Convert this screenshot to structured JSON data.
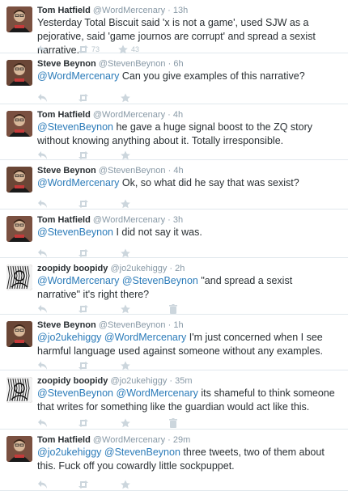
{
  "tweets": [
    {
      "name": "Tom Hatfield",
      "handle": "@WordMercenary",
      "time": "13h",
      "segments": [
        {
          "t": "Yesterday Total Biscuit said 'x is not a game', used SJW as a pejorative, said 'game journos are corrupt' and spread a sexist narrative.",
          "m": false
        }
      ],
      "retweets": "73",
      "favorites": "43",
      "has_delete": false,
      "avatar": "tom"
    },
    {
      "name": "Steve Beynon",
      "handle": "@StevenBeynon",
      "time": "6h",
      "segments": [
        {
          "t": "@WordMercenary",
          "m": true
        },
        {
          "t": " Can you give examples of this narrative?",
          "m": false
        }
      ],
      "retweets": "",
      "favorites": "",
      "has_delete": false,
      "avatar": "steve"
    },
    {
      "name": "Tom Hatfield",
      "handle": "@WordMercenary",
      "time": "4h",
      "segments": [
        {
          "t": "@StevenBeynon",
          "m": true
        },
        {
          "t": " he gave a huge signal boost to the ZQ story without knowing anything about it. Totally irresponsible.",
          "m": false
        }
      ],
      "retweets": "",
      "favorites": "",
      "has_delete": false,
      "avatar": "tom"
    },
    {
      "name": "Steve Beynon",
      "handle": "@StevenBeynon",
      "time": "4h",
      "segments": [
        {
          "t": "@WordMercenary",
          "m": true
        },
        {
          "t": " Ok, so what did he say that was sexist?",
          "m": false
        }
      ],
      "retweets": "",
      "favorites": "",
      "has_delete": false,
      "avatar": "steve"
    },
    {
      "name": "Tom Hatfield",
      "handle": "@WordMercenary",
      "time": "3h",
      "segments": [
        {
          "t": "@StevenBeynon",
          "m": true
        },
        {
          "t": " I did not say it was.",
          "m": false
        }
      ],
      "retweets": "",
      "favorites": "",
      "has_delete": false,
      "avatar": "tom"
    },
    {
      "name": "zoopidy boopidy",
      "handle": "@jo2ukehiggy",
      "time": "2h",
      "segments": [
        {
          "t": "@WordMercenary",
          "m": true
        },
        {
          "t": " ",
          "m": false
        },
        {
          "t": "@StevenBeynon",
          "m": true
        },
        {
          "t": " \"and spread a sexist narrative\" it's right there?",
          "m": false
        }
      ],
      "retweets": "",
      "favorites": "",
      "has_delete": true,
      "avatar": "zoop"
    },
    {
      "name": "Steve Beynon",
      "handle": "@StevenBeynon",
      "time": "1h",
      "segments": [
        {
          "t": "@jo2ukehiggy",
          "m": true
        },
        {
          "t": " ",
          "m": false
        },
        {
          "t": "@WordMercenary",
          "m": true
        },
        {
          "t": " I'm just concerned when I see harmful language used against someone without any examples.",
          "m": false
        }
      ],
      "retweets": "",
      "favorites": "",
      "has_delete": false,
      "avatar": "steve"
    },
    {
      "name": "zoopidy boopidy",
      "handle": "@jo2ukehiggy",
      "time": "35m",
      "segments": [
        {
          "t": "@StevenBeynon",
          "m": true
        },
        {
          "t": " ",
          "m": false
        },
        {
          "t": "@WordMercenary",
          "m": true
        },
        {
          "t": " its shameful to think someone that writes for something like the guardian would act like this.",
          "m": false
        }
      ],
      "retweets": "",
      "favorites": "",
      "has_delete": true,
      "avatar": "zoop"
    },
    {
      "name": "Tom Hatfield",
      "handle": "@WordMercenary",
      "time": "29m",
      "segments": [
        {
          "t": "@jo2ukehiggy",
          "m": true
        },
        {
          "t": " ",
          "m": false
        },
        {
          "t": "@StevenBeynon",
          "m": true
        },
        {
          "t": " three tweets, two of them about this. Fuck off you cowardly little sockpuppet.",
          "m": false
        }
      ],
      "retweets": "",
      "favorites": "",
      "has_delete": false,
      "avatar": "tom"
    }
  ],
  "separator": "·",
  "colors": {
    "mention": "#2b7bb9",
    "meta": "#8899a6",
    "action_icon": "#ccd6dd",
    "divider": "#e1e8ed"
  },
  "icons": {
    "reply": "reply-icon",
    "retweet": "retweet-icon",
    "favorite": "star-icon",
    "delete": "trash-icon"
  }
}
